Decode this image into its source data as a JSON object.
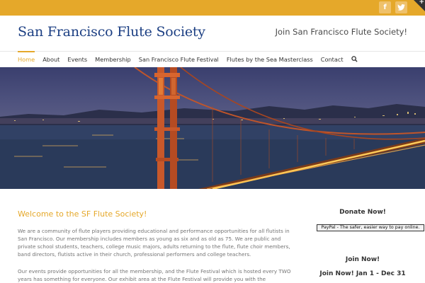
{
  "topbar": {
    "social": [
      {
        "name": "facebook-icon",
        "glyph": "f"
      },
      {
        "name": "twitter-icon",
        "glyph": "🐦"
      }
    ],
    "corner_glyph": "+"
  },
  "header": {
    "site_title": "San Francisco Flute Society",
    "join_link": "Join San Francisco Flute Society!"
  },
  "nav": {
    "items": [
      {
        "label": "Home",
        "active": true
      },
      {
        "label": "About"
      },
      {
        "label": "Events"
      },
      {
        "label": "Membership"
      },
      {
        "label": "San Francisco Flute Festival"
      },
      {
        "label": "Flutes by the Sea Masterclass"
      },
      {
        "label": "Contact"
      }
    ],
    "search_icon": "search-icon"
  },
  "main": {
    "heading": "Welcome to the SF Flute Society!",
    "paragraph1": "We are a community of flute players providing educational and performance opportunities for all flutists in San Francisco. Our membership includes members as young as six and as old as 75. We are public and private school students, teachers, college music majors, adults returning to the flute, flute choir members, band directors, flutists active in their church, professional performers and college teachers.",
    "paragraph2": "Our events provide opportunities for all the membership, and the Flute Festival which is hosted every TWO years has something for everyone. Our exhibit area at the Flute Festival will provide you with the"
  },
  "sidebar": {
    "donate_heading": "Donate Now!",
    "paypal_label": "PayPal - The safer, easier way to pay online.",
    "join_heading": "Join Now!",
    "join_range": "Join Now! Jan 1 - Dec 31"
  },
  "colors": {
    "accent": "#e5a82a",
    "title_blue": "#1c3f83",
    "body_text": "#747474"
  }
}
